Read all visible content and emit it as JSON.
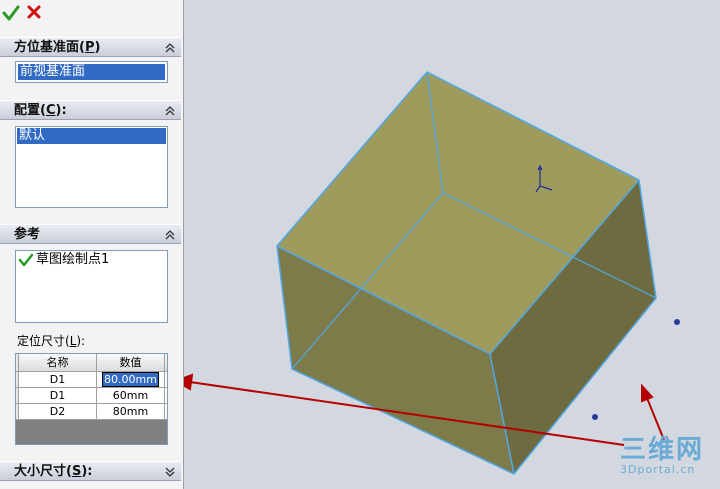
{
  "toolbar": {
    "ok_icon": "check-icon",
    "cancel_icon": "close-icon"
  },
  "orientation_group": {
    "title_prefix": "方位基准面(",
    "title_key": "P",
    "title_suffix": ")",
    "selected_value": "前视基准面"
  },
  "config_group": {
    "title_prefix": "配置(",
    "title_key": "C",
    "title_suffix": "):",
    "items": [
      "默认"
    ]
  },
  "reference_group": {
    "title": "参考",
    "items": [
      {
        "label": "草图绘制点1",
        "icon": "check-icon"
      }
    ],
    "positioning_label_prefix": "定位尺寸(",
    "positioning_label_key": "L",
    "positioning_label_suffix": "):",
    "table": {
      "headers": [
        "名称",
        "数值"
      ],
      "rows": [
        {
          "name": "D1",
          "value": "80.00mm"
        },
        {
          "name": "D1",
          "value": "60mm"
        },
        {
          "name": "D2",
          "value": "80mm"
        }
      ]
    }
  },
  "size_group": {
    "title_prefix": "大小尺寸(",
    "title_key": "S",
    "title_suffix": "):"
  },
  "watermark": {
    "main": "三维网",
    "sub": "3Dportal.cn"
  },
  "colors": {
    "selection": "#316ac5",
    "cube_top": "#9e9b5c",
    "cube_left": "#7d7a4a",
    "cube_right": "#6d6a3f",
    "cube_edge": "#4fa8e8",
    "arrow": "#b40000"
  }
}
